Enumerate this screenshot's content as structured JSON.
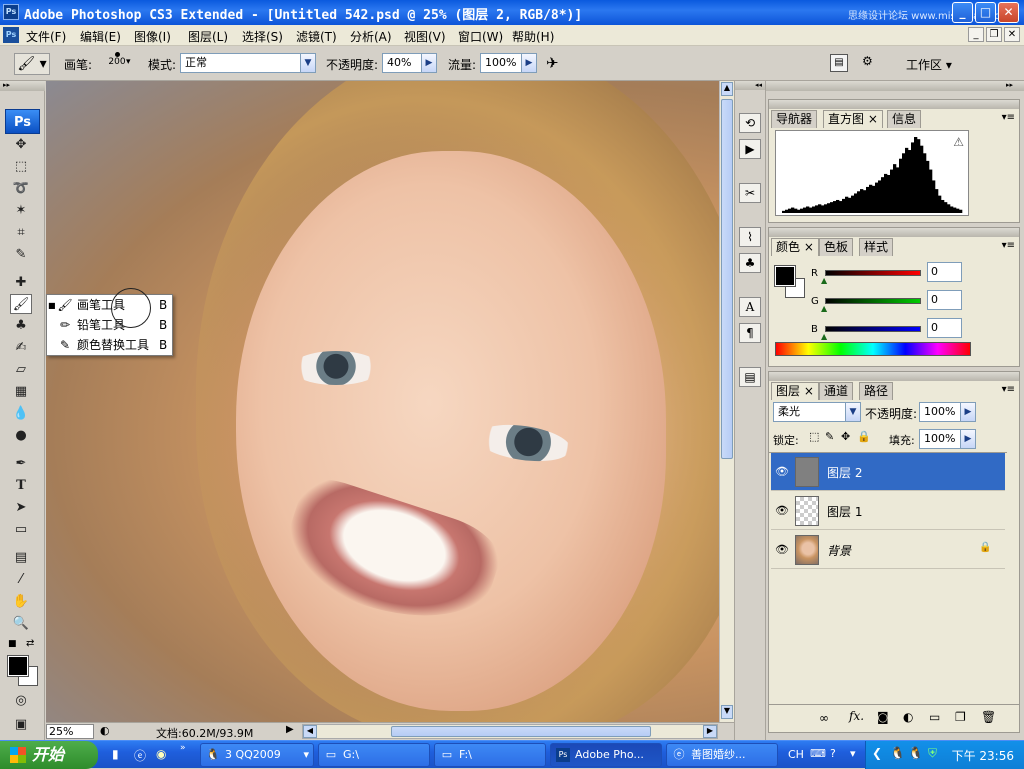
{
  "window": {
    "ps_badge": "Ps",
    "title": "Adobe Photoshop CS3 Extended - [Untitled 542.psd @ 25% (图层 2, RGB/8*)]",
    "watermark": "思缘设计论坛 www.missyuan.com",
    "minimize": "_",
    "maximize": "□",
    "close": "✕"
  },
  "menubar": {
    "items": [
      "文件(F)",
      "编辑(E)",
      "图像(I)",
      "图层(L)",
      "选择(S)",
      "滤镜(T)",
      "分析(A)",
      "视图(V)",
      "窗口(W)",
      "帮助(H)"
    ],
    "doc_min": "_",
    "doc_restore": "❐",
    "doc_close": "✕"
  },
  "options": {
    "brush_label": "画笔:",
    "brush_size": "200",
    "mode_label": "模式:",
    "mode_value": "正常",
    "opacity_label": "不透明度:",
    "opacity_value": "40%",
    "flow_label": "流量:",
    "flow_value": "100%",
    "workspace_label": "工作区 ▾"
  },
  "toolbox": {
    "logo": "Ps"
  },
  "tool_flyout": {
    "items": [
      {
        "label": "画笔工具",
        "key": "B",
        "icon": "brush-icon"
      },
      {
        "label": "铅笔工具",
        "key": "B",
        "icon": "pencil-icon"
      },
      {
        "label": "颜色替换工具",
        "key": "B",
        "icon": "color-replace-icon"
      }
    ]
  },
  "status": {
    "zoom": "25%",
    "docsize": "文档:60.2M/93.9M"
  },
  "navigator_panel": {
    "tabs": [
      "导航器",
      "直方图",
      "信息"
    ],
    "active_tab": "直方图",
    "warning": "⚠",
    "histogram": [
      2,
      3,
      4,
      5,
      4,
      3,
      4,
      5,
      6,
      5,
      6,
      7,
      8,
      7,
      8,
      9,
      10,
      11,
      12,
      11,
      13,
      15,
      14,
      16,
      18,
      20,
      22,
      21,
      24,
      26,
      25,
      28,
      30,
      33,
      36,
      35,
      40,
      45,
      42,
      50,
      55,
      60,
      58,
      65,
      70,
      68,
      62,
      55,
      48,
      40,
      30,
      22,
      16,
      12,
      10,
      8,
      6,
      5,
      4,
      3
    ]
  },
  "color_panel": {
    "tabs": [
      "颜色",
      "色板",
      "样式"
    ],
    "active_tab": "颜色",
    "channels": [
      {
        "label": "R",
        "value": "0",
        "color": "#e00000"
      },
      {
        "label": "G",
        "value": "0",
        "color": "#00c000"
      },
      {
        "label": "B",
        "value": "0",
        "color": "#0000e0"
      }
    ]
  },
  "layers_panel": {
    "tabs": [
      "图层",
      "通道",
      "路径"
    ],
    "active_tab": "图层",
    "blend_mode": "柔光",
    "opacity_label": "不透明度:",
    "opacity_value": "100%",
    "lock_label": "锁定:",
    "fill_label": "填充:",
    "fill_value": "100%",
    "layers": [
      {
        "name": "图层 2",
        "selected": true,
        "thumb": "gray"
      },
      {
        "name": "图层 1",
        "selected": false,
        "thumb": "transparent"
      },
      {
        "name": "背景",
        "selected": false,
        "thumb": "photo",
        "locked": true
      }
    ],
    "footer_icons": [
      "link-icon",
      "fx-icon",
      "mask-icon",
      "adjustment-icon",
      "folder-icon",
      "new-layer-icon",
      "trash-icon"
    ]
  },
  "taskbar": {
    "start": "开始",
    "tasks": [
      {
        "label": "3 QQ2009",
        "active": false
      },
      {
        "label": "G:\\",
        "active": false
      },
      {
        "label": "F:\\",
        "active": false
      },
      {
        "label": "Adobe Pho...",
        "active": true
      },
      {
        "label": "善图婚纱...",
        "active": false
      }
    ],
    "ime": "CH",
    "clock": "下午 23:56"
  },
  "colors": {
    "title_blue": "#0a5ade",
    "selected_layer": "#316ac5",
    "foreground": "#000000",
    "background": "#ffffff"
  }
}
